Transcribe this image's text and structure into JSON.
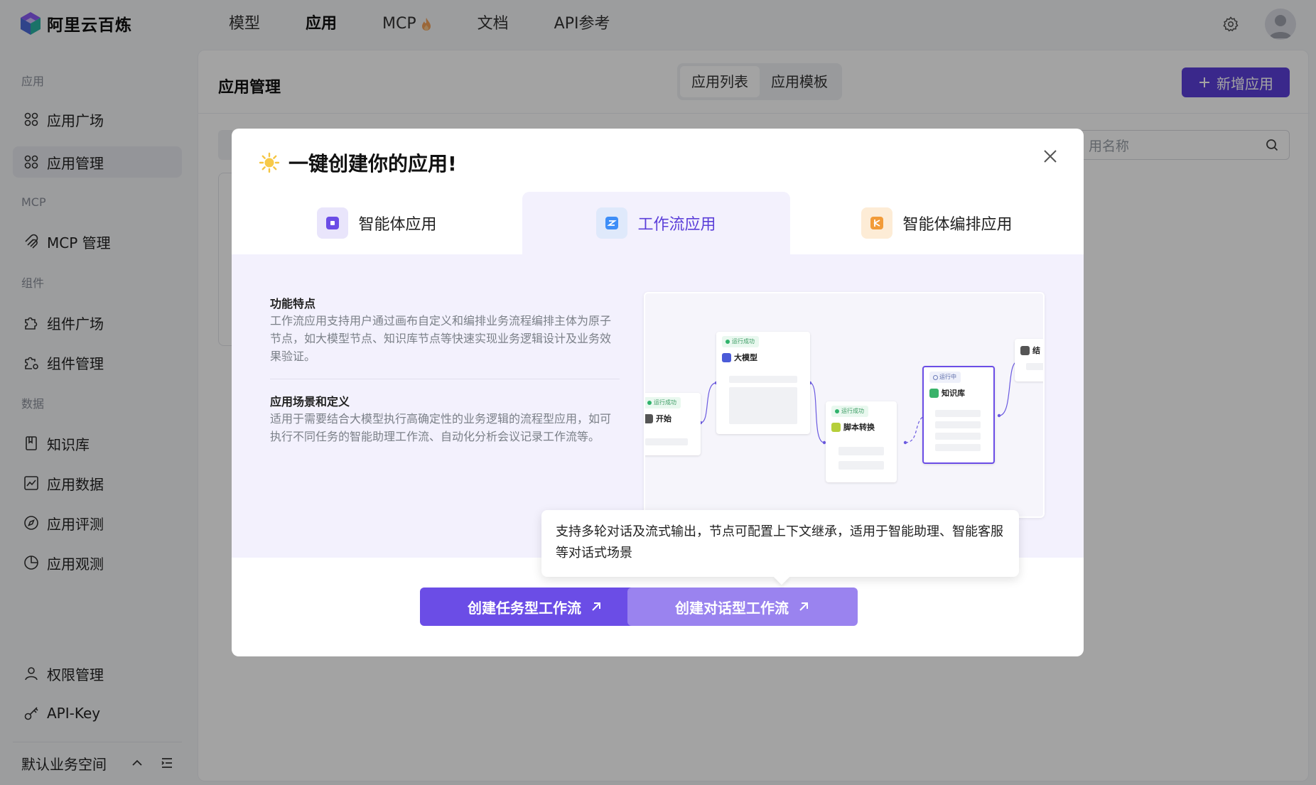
{
  "app": {
    "name": "阿里云百炼"
  },
  "nav": [
    {
      "label": "模型"
    },
    {
      "label": "应用"
    },
    {
      "label": "MCP"
    },
    {
      "label": "文档"
    },
    {
      "label": "API参考"
    }
  ],
  "sidebar": {
    "groups": [
      "应用",
      "MCP",
      "组件",
      "数据"
    ],
    "items": [
      {
        "label": "应用广场",
        "icon": "grid-icon"
      },
      {
        "label": "应用管理",
        "icon": "grid-icon"
      },
      {
        "label": "MCP 管理",
        "icon": "mcp-icon"
      },
      {
        "label": "组件广场",
        "icon": "puzzle-icon"
      },
      {
        "label": "组件管理",
        "icon": "puzzle-gear-icon"
      },
      {
        "label": "知识库",
        "icon": "book-icon"
      },
      {
        "label": "应用数据",
        "icon": "chart-icon"
      },
      {
        "label": "应用评测",
        "icon": "compass-icon"
      },
      {
        "label": "应用观测",
        "icon": "pie-icon"
      },
      {
        "label": "权限管理",
        "icon": "user-icon"
      },
      {
        "label": "API-Key",
        "icon": "key-icon"
      }
    ],
    "workspace": "默认业务空间"
  },
  "main": {
    "title": "应用管理",
    "segments": [
      "应用列表",
      "应用模板"
    ],
    "new_button": "新增应用",
    "search_placeholder": "用名称"
  },
  "modal": {
    "title": "一键创建你的应用!",
    "tabs": [
      {
        "label": "智能体应用",
        "icon": "agent-icon",
        "color": "#6b4de6"
      },
      {
        "label": "工作流应用",
        "icon": "workflow-icon",
        "color": "#3e8ef7"
      },
      {
        "label": "智能体编排应用",
        "icon": "orchestration-icon",
        "color": "#f29b38"
      }
    ],
    "features_title": "功能特点",
    "features_text": "工作流应用支持用户通过画布自定义和编排业务流程编排主体为原子节点，如大模型节点、知识库节点等快速实现业务逻辑设计及业务效果验证。",
    "scenario_title": "应用场景和定义",
    "scenario_text": "适用于需要结合大模型执行高确定性的业务逻辑的流程型应用，如可执行不同任务的智能助理工作流、自动化分析会议记录工作流等。",
    "preview": {
      "nodes": [
        {
          "status": "运行成功",
          "name": "开始"
        },
        {
          "status": "运行成功",
          "name": "大模型"
        },
        {
          "status": "运行成功",
          "name": "脚本转换"
        },
        {
          "status": "运行中",
          "name": "知识库"
        },
        {
          "status": "",
          "name": "结"
        }
      ]
    },
    "tooltip": "支持多轮对话及流式输出，节点可配置上下文继承，适用于智能助理、智能客服等对话式场景",
    "buttons": [
      {
        "label": "创建任务型工作流",
        "color": "#6b4de6"
      },
      {
        "label": "创建对话型工作流",
        "color": "#9a83ef"
      }
    ]
  },
  "colors": {
    "accent": "#5b3fd9",
    "overlay": "rgba(0,0,0,0.36)"
  }
}
